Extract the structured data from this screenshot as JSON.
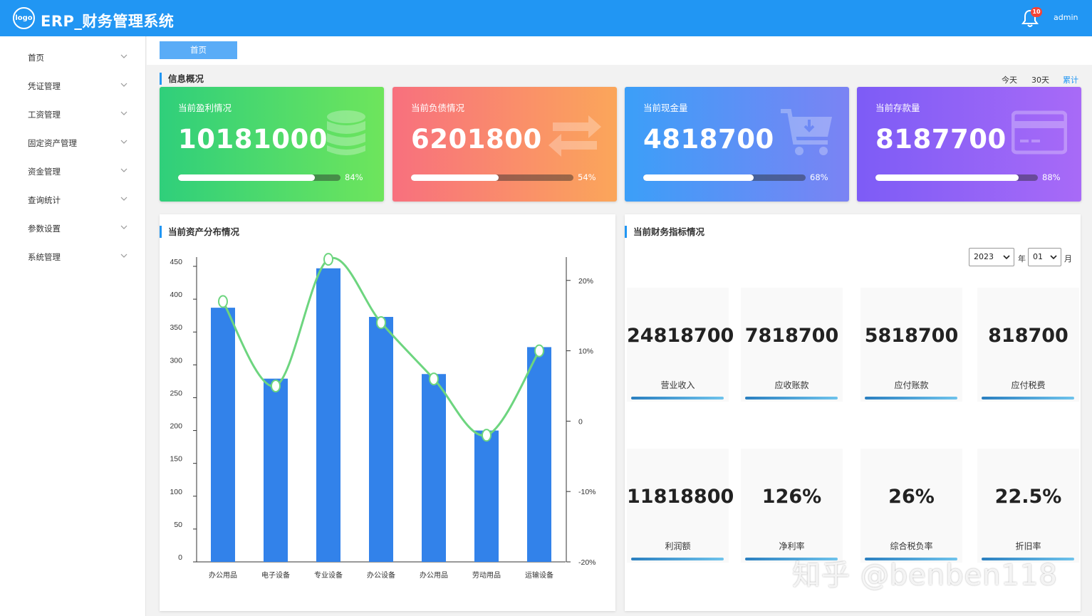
{
  "header": {
    "logo_text": "logo",
    "title": "ERP_财务管理系统",
    "notification_count": "10",
    "user": "admin",
    "bg_color": "#2196f3"
  },
  "sidebar": {
    "items": [
      {
        "label": "首页"
      },
      {
        "label": "凭证管理"
      },
      {
        "label": "工资管理"
      },
      {
        "label": "固定资产管理"
      },
      {
        "label": "资金管理"
      },
      {
        "label": "查询统计"
      },
      {
        "label": "参数设置"
      },
      {
        "label": "系统管理"
      }
    ]
  },
  "tabs": {
    "home": "首页"
  },
  "overview": {
    "title": "信息概况",
    "ranges": [
      "今天",
      "30天",
      "累计"
    ],
    "active_range": "累计",
    "cards": [
      {
        "title": "当前盈利情况",
        "value": "10181000",
        "percent": 84,
        "percent_label": "84%",
        "icon": "database-icon"
      },
      {
        "title": "当前负债情况",
        "value": "6201800",
        "percent": 54,
        "percent_label": "54%",
        "icon": "exchange-arrows-icon"
      },
      {
        "title": "当前现金量",
        "value": "4818700",
        "percent": 68,
        "percent_label": "68%",
        "icon": "shopping-cart-icon"
      },
      {
        "title": "当前存款量",
        "value": "8187700",
        "percent": 88,
        "percent_label": "88%",
        "icon": "credit-card-icon"
      }
    ]
  },
  "asset_panel": {
    "title": "当前资产分布情况"
  },
  "chart_data": {
    "type": "bar",
    "categories": [
      "办公用品",
      "电子设备",
      "专业设备",
      "办公设备",
      "办公用品",
      "劳动用品",
      "运输设备"
    ],
    "series": [
      {
        "type": "bar",
        "axis": "left",
        "values": [
          387,
          279,
          447,
          373,
          286,
          200,
          327
        ],
        "color": "#3282ea"
      },
      {
        "type": "line",
        "smooth": true,
        "axis": "right",
        "values": [
          17,
          5,
          23,
          14,
          6,
          -2,
          10
        ],
        "color": "#6dd57f"
      }
    ],
    "y_left": {
      "ticks": [
        "0",
        "50",
        "100",
        "150",
        "200",
        "250",
        "300",
        "350",
        "400",
        "450"
      ],
      "ylim": [
        0,
        450
      ]
    },
    "y_right": {
      "ticks": [
        "-20%",
        "-10%",
        "0",
        "10%",
        "20%"
      ],
      "ylim": [
        -20,
        22
      ]
    },
    "grid": false
  },
  "finance_panel": {
    "title": "当前财务指标情况",
    "year": "2023",
    "year_suffix": "年",
    "month": "01",
    "month_suffix": "月",
    "tiles": [
      {
        "value": "24818700",
        "label": "营业收入"
      },
      {
        "value": "7818700",
        "label": "应收账款"
      },
      {
        "value": "5818700",
        "label": "应付账款"
      },
      {
        "value": "818700",
        "label": "应付税费"
      },
      {
        "value": "11818800",
        "label": "利润额"
      },
      {
        "value": "126%",
        "label": "净利率"
      },
      {
        "value": "26%",
        "label": "综合税负率"
      },
      {
        "value": "22.5%",
        "label": "折旧率"
      }
    ]
  },
  "watermark": "知乎 @benben118"
}
